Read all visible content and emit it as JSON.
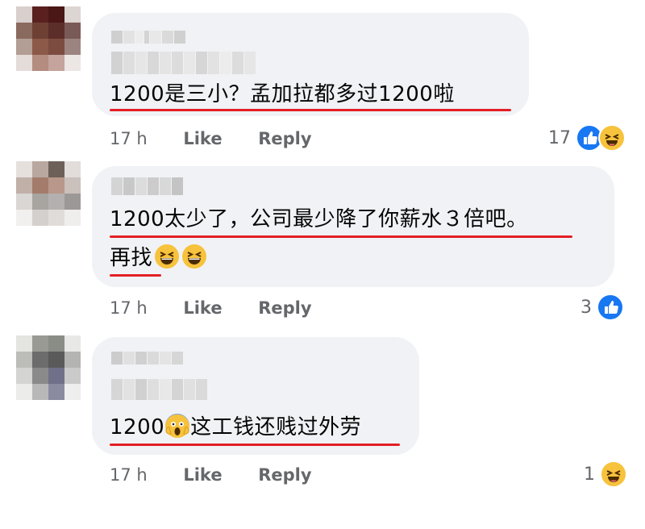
{
  "comments": [
    {
      "text": "1200是三小？孟加拉都多过1200啦",
      "time": "17 h",
      "like_label": "Like",
      "reply_label": "Reply",
      "reaction_count": "17",
      "reactions": [
        "like-icon",
        "haha-icon"
      ]
    },
    {
      "text_line1": "1200太少了，公司最少降了你薪水３倍吧。",
      "text_line2": "再找",
      "time": "17 h",
      "like_label": "Like",
      "reply_label": "Reply",
      "reaction_count": "3",
      "reactions": [
        "like-icon"
      ]
    },
    {
      "text_before": "1200",
      "text_after": "这工钱还贱过外劳",
      "time": "17 h",
      "like_label": "Like",
      "reply_label": "Reply",
      "reaction_count": "1",
      "reactions": [
        "haha-icon"
      ]
    }
  ],
  "colors": {
    "bubble": "#f0f2f5",
    "underline": "#e41e26",
    "meta_text": "#65676b",
    "like_blue": "#1877f2",
    "haha_yellow": "#f7c23c"
  }
}
